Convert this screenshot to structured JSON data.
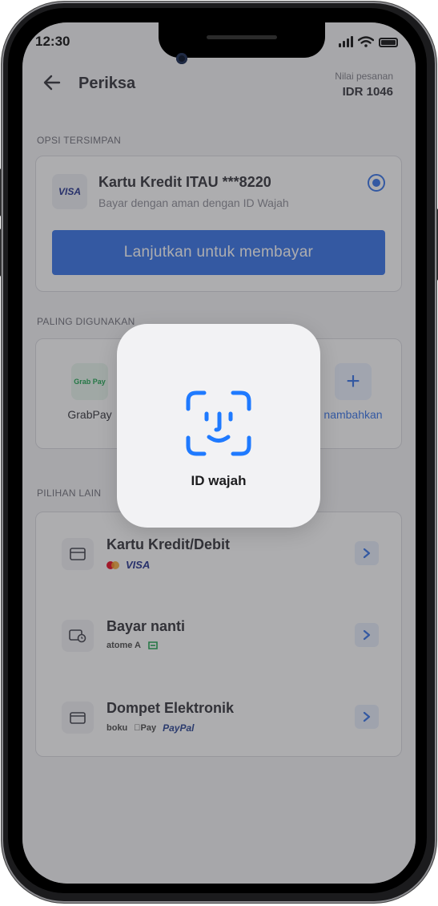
{
  "status_bar": {
    "time": "12:30"
  },
  "header": {
    "title": "Periksa",
    "order_label": "Nilai pesanan",
    "order_value": "IDR 1046"
  },
  "saved_options": {
    "section_label": "OPSI TERSIMPAN",
    "card_brand": "VISA",
    "card_title": "Kartu Kredit ITAU ***8220",
    "card_subtitle": "Bayar dengan aman dengan ID Wajah",
    "selected": true,
    "pay_button_label": "Lanjutkan untuk membayar"
  },
  "most_used": {
    "section_label": "PALING DIGUNAKAN",
    "items": [
      {
        "icon_text": "Grab Pay",
        "label": "GrabPay"
      },
      {
        "icon": "plus-icon",
        "label": "nambahkan"
      }
    ]
  },
  "other_options": {
    "section_label": "PILIHAN LAIN",
    "items": [
      {
        "title": "Kartu Kredit/Debit",
        "icon": "credit-card-icon",
        "logos": [
          "mastercard",
          "VISA"
        ]
      },
      {
        "title": "Bayar nanti",
        "icon": "bill-clock-icon",
        "logos": [
          "atome A",
          "akulaku"
        ]
      },
      {
        "title": "Dompet Elektronik",
        "icon": "wallet-icon",
        "logos": [
          "boku",
          "Pay",
          "PayPal"
        ]
      }
    ]
  },
  "face_id_dialog": {
    "label": "ID wajah"
  },
  "colors": {
    "accent": "#2f6fe8",
    "overlay": "#3c3c40"
  }
}
